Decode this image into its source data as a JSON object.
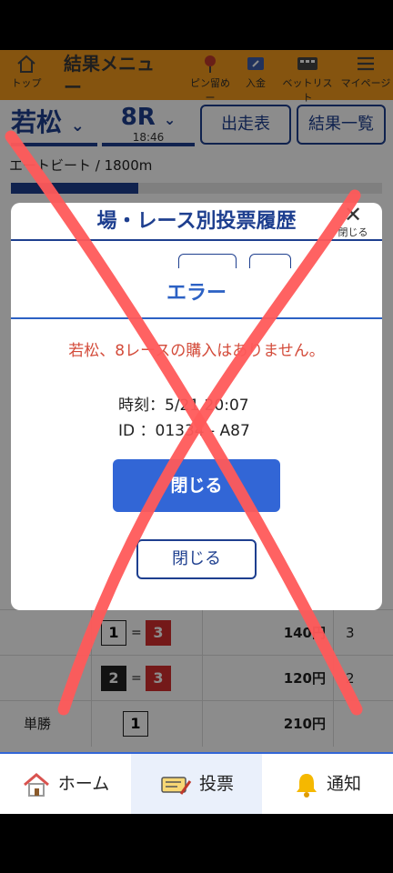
{
  "header": {
    "title": "結果メニュー",
    "nav": [
      {
        "label": "トップ",
        "icon": "home-icon"
      },
      {
        "label": "ピン留めー",
        "icon": "pin-icon"
      },
      {
        "label": "入金",
        "icon": "deposit-icon"
      },
      {
        "label": "ベットリスト",
        "icon": "betlist-icon"
      },
      {
        "label": "マイページ",
        "icon": "menu-icon"
      }
    ]
  },
  "race_selector": {
    "venue": "若松",
    "race": "8R",
    "time": "18:46",
    "entry_button": "出走表",
    "results_button": "結果一覧"
  },
  "race_info": "エートビート / 1800m",
  "results": [
    {
      "first": "1",
      "second": "3",
      "amount": "140円",
      "pop": "3"
    },
    {
      "first": "2",
      "second": "3",
      "amount": "120円",
      "pop": "2"
    },
    {
      "label": "単勝",
      "first": "1",
      "amount": "210円",
      "pop": ""
    }
  ],
  "history_modal": {
    "title": "場・レース別投票履歴",
    "close_label": "閉じる",
    "close_button": "閉じる"
  },
  "error_modal": {
    "title": "エラー",
    "message": "若松、8レースの購入はありません。",
    "time_line": "時刻：5/21 20:07",
    "id_line": "ID ：01334 - A87",
    "close_button": "閉じる"
  },
  "bottom_nav": [
    {
      "label": "ホーム",
      "icon": "house-icon",
      "active": false
    },
    {
      "label": "投票",
      "icon": "ticket-icon",
      "active": true
    },
    {
      "label": "通知",
      "icon": "bell-icon",
      "active": false
    }
  ],
  "colors": {
    "accent": "#1e3f8f",
    "error": "#d34b3a",
    "primary_button": "#3266d6",
    "header": "#f39a1c",
    "cross": "#ff5a5a"
  }
}
